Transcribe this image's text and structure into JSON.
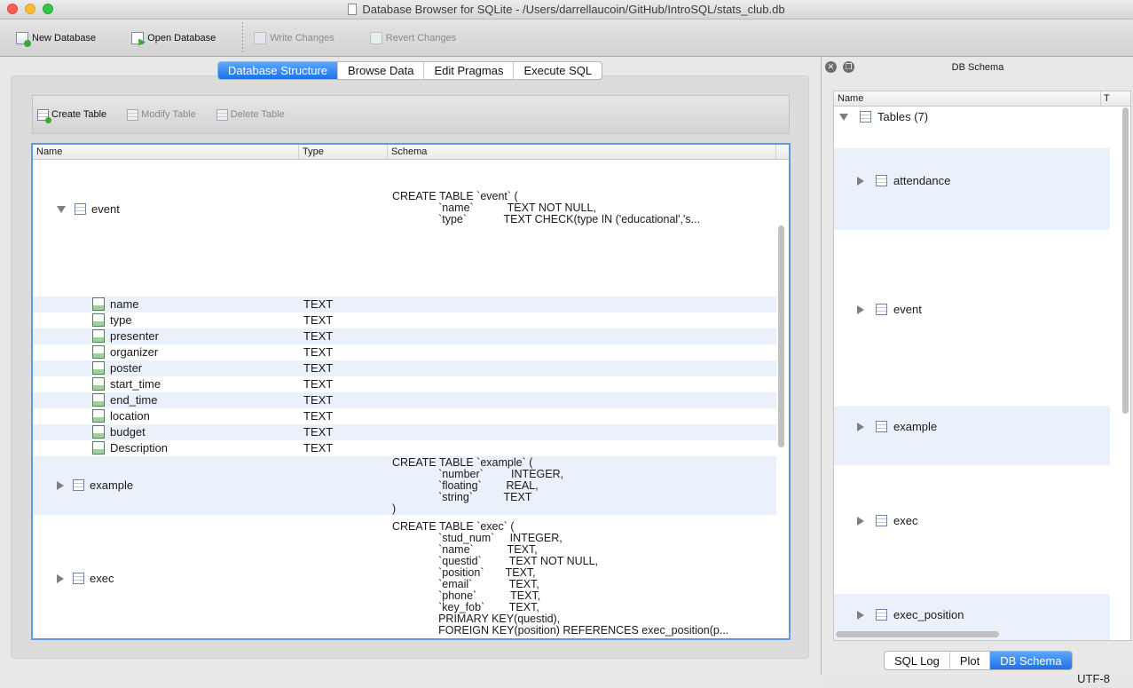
{
  "window": {
    "title": "Database Browser for SQLite - /Users/darrellaucoin/GitHub/IntroSQL/stats_club.db"
  },
  "toolbar": {
    "new_db": "New Database",
    "open_db": "Open Database",
    "write": "Write Changes",
    "revert": "Revert Changes"
  },
  "tabs": [
    "Database Structure",
    "Browse Data",
    "Edit Pragmas",
    "Execute SQL"
  ],
  "subtoolbar": {
    "create": "Create Table",
    "modify": "Modify Table",
    "delete": "Delete Table"
  },
  "tree": {
    "headers": [
      "Name",
      "Type",
      "Schema"
    ],
    "event": {
      "name": "event",
      "schema": "CREATE TABLE `event` (\n               `name`           TEXT NOT NULL,\n               `type`            TEXT CHECK(type IN ('educational','s..."
    },
    "fields": [
      {
        "name": "name",
        "type": "TEXT"
      },
      {
        "name": "type",
        "type": "TEXT"
      },
      {
        "name": "presenter",
        "type": "TEXT"
      },
      {
        "name": "organizer",
        "type": "TEXT"
      },
      {
        "name": "poster",
        "type": "TEXT"
      },
      {
        "name": "start_time",
        "type": "TEXT"
      },
      {
        "name": "end_time",
        "type": "TEXT"
      },
      {
        "name": "location",
        "type": "TEXT"
      },
      {
        "name": "budget",
        "type": "TEXT"
      },
      {
        "name": "Description",
        "type": "TEXT"
      }
    ],
    "example": {
      "name": "example",
      "schema": "CREATE TABLE `example` (\n               `number`         INTEGER,\n               `floating`        REAL,\n               `string`          TEXT\n)"
    },
    "exec": {
      "name": "exec",
      "schema": "CREATE TABLE `exec` (\n               `stud_num`     INTEGER,\n               `name`           TEXT,\n               `questid`         TEXT NOT NULL,\n               `position`       TEXT,\n               `email`            TEXT,\n               `phone`           TEXT,\n               `key_fob`        TEXT,\n               PRIMARY KEY(questid),\n               FOREIGN KEY(position) REFERENCES exec_position(p..."
    }
  },
  "dock": {
    "title": "DB Schema",
    "header_name": "Name",
    "header_type": "T",
    "root": "Tables (7)",
    "items": [
      "attendance",
      "event",
      "example",
      "exec",
      "exec_position"
    ]
  },
  "bottom_tabs": [
    "SQL Log",
    "Plot",
    "DB Schema"
  ],
  "status": {
    "encoding": "UTF-8"
  }
}
